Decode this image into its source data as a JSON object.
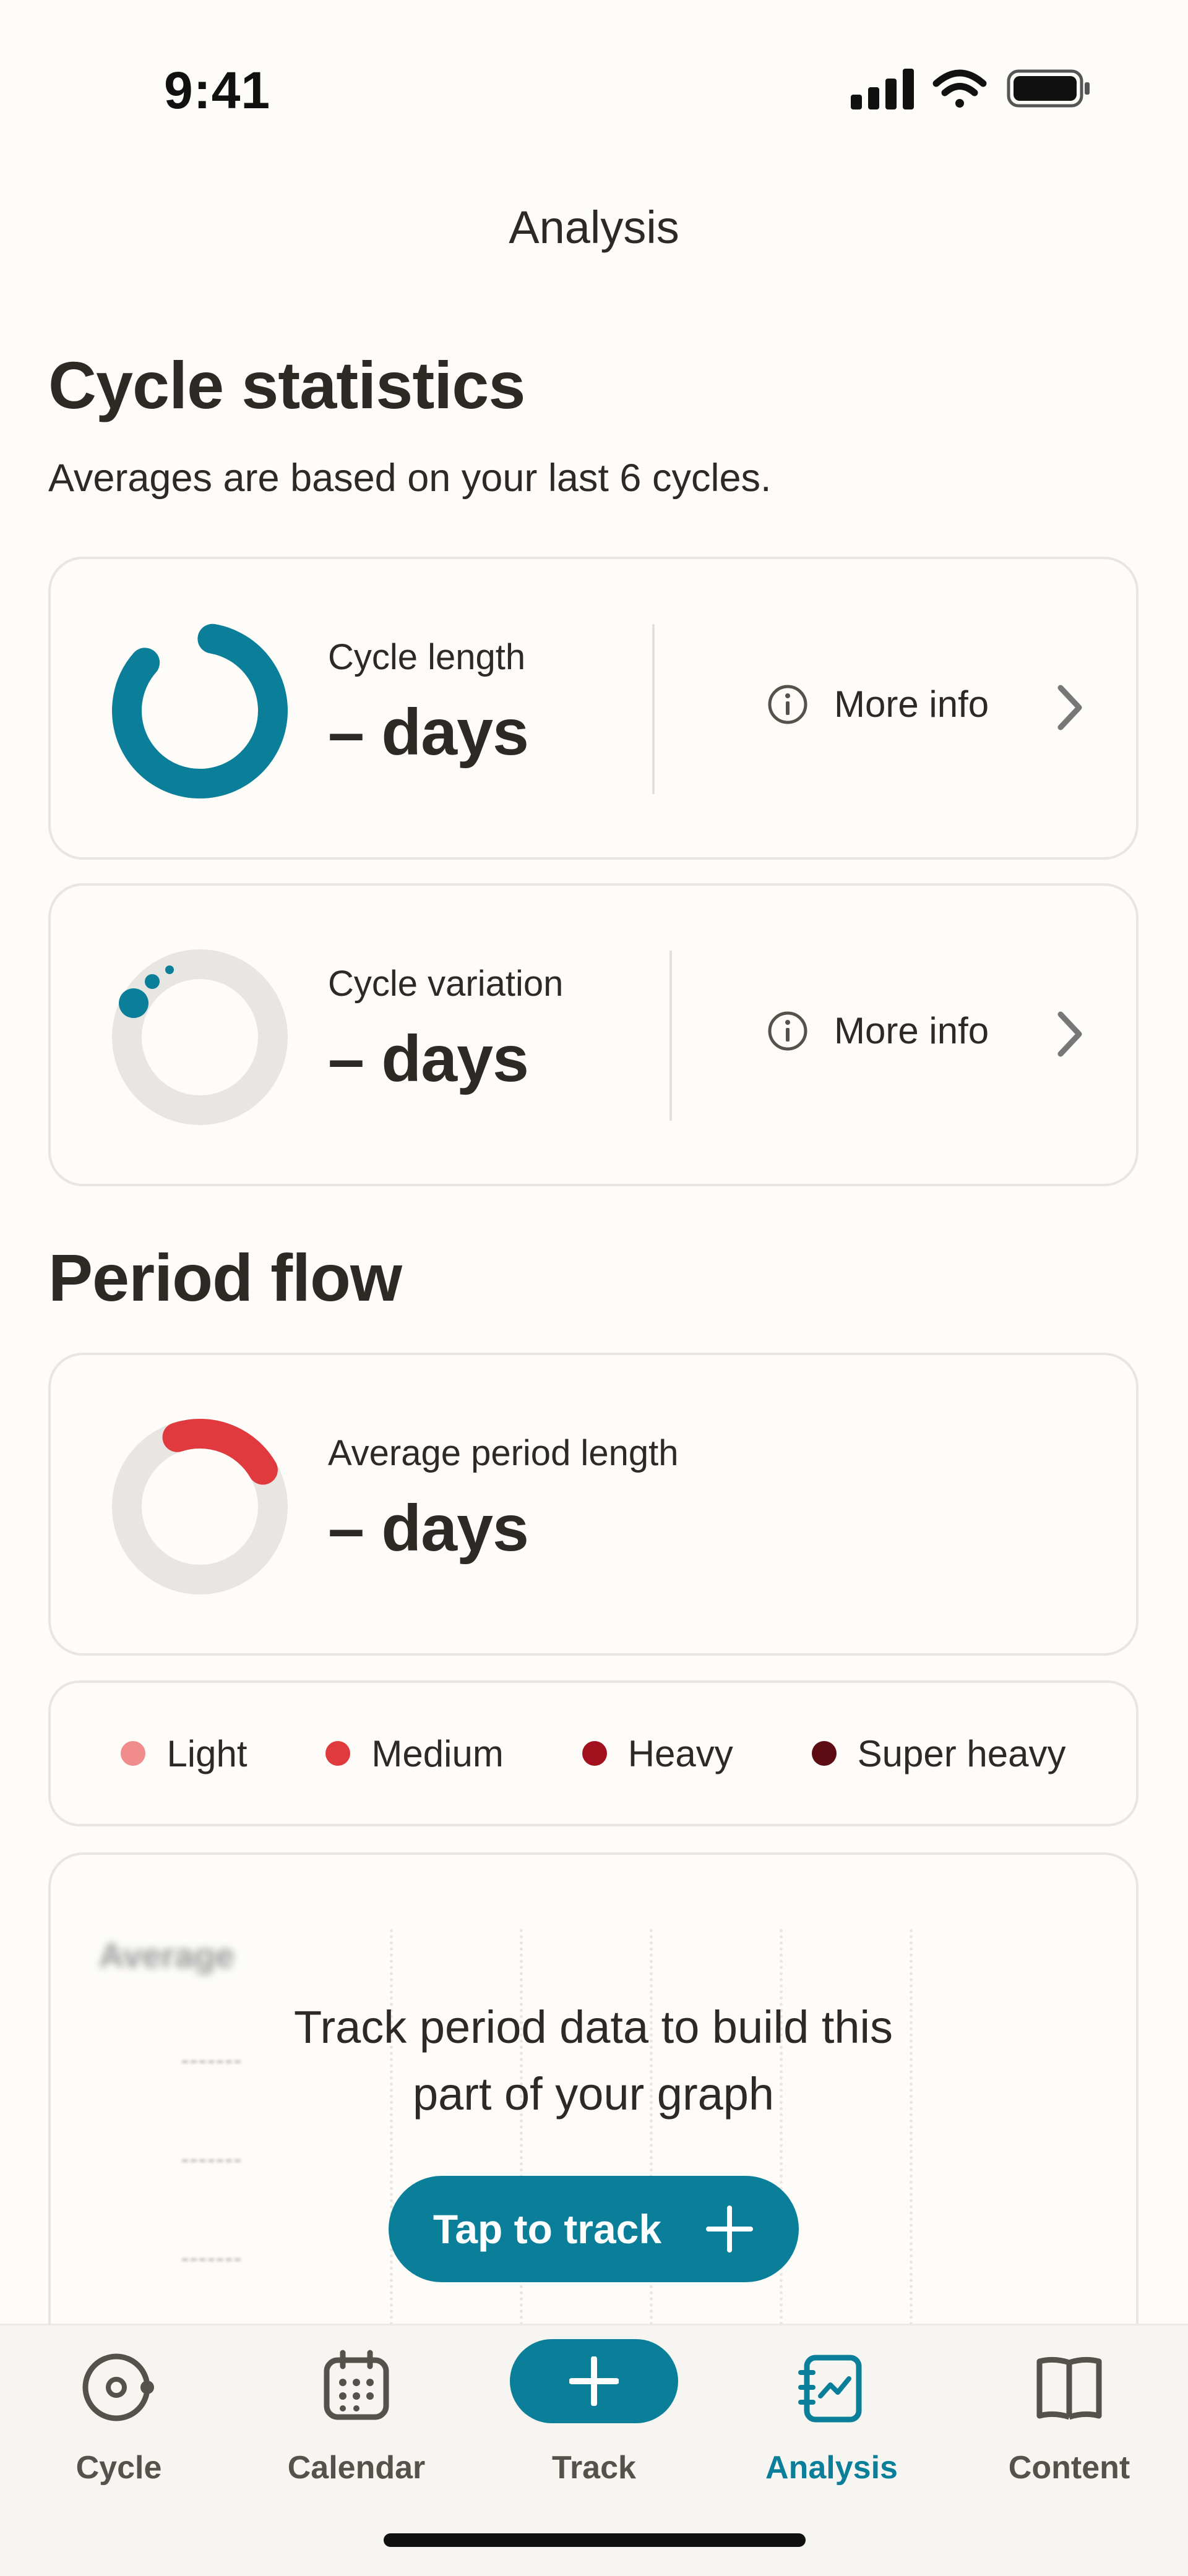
{
  "status_bar": {
    "time": "9:41",
    "icons": [
      "signal-icon",
      "wifi-icon",
      "battery-icon"
    ]
  },
  "nav": {
    "title": "Analysis"
  },
  "cycle_statistics": {
    "title": "Cycle statistics",
    "subtitle": "Averages are based on your last 6 cycles.",
    "cards": [
      {
        "label": "Cycle length",
        "value": "– days",
        "more_info": "More info",
        "icon": "cycle-length-ring-icon",
        "color": "#0b7f99"
      },
      {
        "label": "Cycle variation",
        "value": "– days",
        "more_info": "More info",
        "icon": "cycle-variation-ring-icon",
        "color": "#0b7f99"
      }
    ]
  },
  "period_flow": {
    "title": "Period flow",
    "card": {
      "label": "Average period length",
      "value": "– days",
      "icon": "period-length-ring-icon",
      "color": "#e03a3e"
    },
    "legend": [
      {
        "label": "Light",
        "color": "#f08c8c"
      },
      {
        "label": "Medium",
        "color": "#e03a3e"
      },
      {
        "label": "Heavy",
        "color": "#a3101e"
      },
      {
        "label": "Super heavy",
        "color": "#5c0c12"
      }
    ],
    "graph": {
      "placeholder_label": "Average",
      "message": "Track period data to build this part of your graph",
      "button_label": "Tap to track"
    }
  },
  "tab_bar": {
    "items": [
      {
        "label": "Cycle",
        "icon": "cycle-icon",
        "active": false
      },
      {
        "label": "Calendar",
        "icon": "calendar-icon",
        "active": false
      },
      {
        "label": "Track",
        "icon": "plus-icon",
        "active": false
      },
      {
        "label": "Analysis",
        "icon": "analysis-icon",
        "active": true
      },
      {
        "label": "Content",
        "icon": "book-icon",
        "active": false
      }
    ]
  },
  "colors": {
    "accent": "#0b7f99",
    "background": "#fdfcf9",
    "text": "#2d2a26",
    "period_red": "#e03a3e"
  }
}
